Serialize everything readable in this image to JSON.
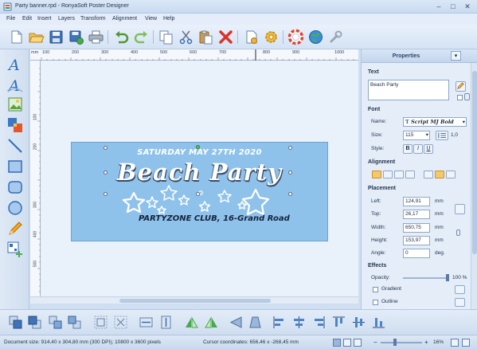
{
  "window": {
    "title": "Party banner.rpd - RonyaSoft Poster Designer",
    "controls": [
      "–",
      "□",
      "✕"
    ]
  },
  "menu": [
    "File",
    "Edit",
    "Insert",
    "Layers",
    "Transform",
    "Alignment",
    "View",
    "Help"
  ],
  "toolbar": {
    "buttons": [
      "new-document-icon",
      "open-folder-icon",
      "save-icon",
      "save-as-icon",
      "print-icon",
      "undo-icon",
      "redo-icon",
      "copy-icon",
      "cut-icon",
      "paste-icon",
      "delete-icon",
      "page-setup-icon",
      "settings-icon",
      "help-icon",
      "web-icon",
      "wrench-icon"
    ]
  },
  "left_tools": [
    "text-tool-icon",
    "curved-text-tool-icon",
    "image-tool-icon",
    "clipart-tool-icon",
    "line-tool-icon",
    "rectangle-tool-icon",
    "rounded-rect-tool-icon",
    "ellipse-tool-icon",
    "pencil-tool-icon",
    "qr-code-tool-icon"
  ],
  "rulers": {
    "unit": "mm",
    "top_labels": [
      "mm",
      "100",
      "200",
      "300",
      "400",
      "500",
      "600",
      "700",
      "800",
      "900",
      "1000"
    ],
    "left_labels": [
      "100",
      "200",
      "300",
      "400",
      "500"
    ]
  },
  "banner": {
    "date_line": "SATURDAY MAY 27TH 2020",
    "title": "Beach Party",
    "subtitle": "PARTYZONE CLUB, 16-Grand Road",
    "background": "#8fc2ea"
  },
  "properties": {
    "header": "Properties",
    "text_section": "Text",
    "text_value": "Beach Party",
    "font_section": "Font",
    "name_label": "Name:",
    "font_name": "Script MJ Bold",
    "size_label": "Size:",
    "font_size": "115",
    "line_spacing": "1,0",
    "style_label": "Style:",
    "style_buttons": [
      "B",
      "I",
      "U"
    ],
    "alignment_section": "Alignment",
    "placement_section": "Placement",
    "left_label": "Left:",
    "left_value": "124,91",
    "top_label": "Top:",
    "top_value": "26,17",
    "width_label": "Width:",
    "width_value": "650,75",
    "height_label": "Height:",
    "height_value": "153,97",
    "angle_label": "Angle:",
    "angle_value": "0",
    "unit_mm": "mm",
    "unit_deg": "deg.",
    "effects_section": "Effects",
    "opacity_label": "Opacity:",
    "opacity_value": "100 %",
    "opacity_level": 1.0,
    "gradient_label": "Gradient",
    "outline_label": "Outline"
  },
  "bottom_tools": [
    "bring-to-front-icon",
    "send-to-back-icon",
    "bring-forward-icon",
    "send-backward-icon",
    "group-icon",
    "ungroup-icon",
    "fit-width-icon",
    "fit-height-icon",
    "flip-horizontal-icon",
    "flip-vertical-icon",
    "skew-left-icon",
    "skew-right-icon",
    "align-left-icon",
    "align-center-icon",
    "align-right-icon",
    "align-top-icon",
    "align-middle-icon",
    "align-bottom-icon",
    "distribute-horizontal-icon",
    "distribute-vertical-icon"
  ],
  "status": {
    "document_size": "Document size: 914,40 x 304,80 mm (300 DPI); 10800 x 3600 pixels",
    "cursor": "Cursor coordinates: 656,46 x -268,45 mm",
    "zoom": "16%",
    "zoom_minus": "−",
    "zoom_plus": "+"
  },
  "colors": {
    "accent": "#2f6fb8",
    "banner_bg": "#8fc2ea",
    "subtitle_text": "#13233c"
  }
}
